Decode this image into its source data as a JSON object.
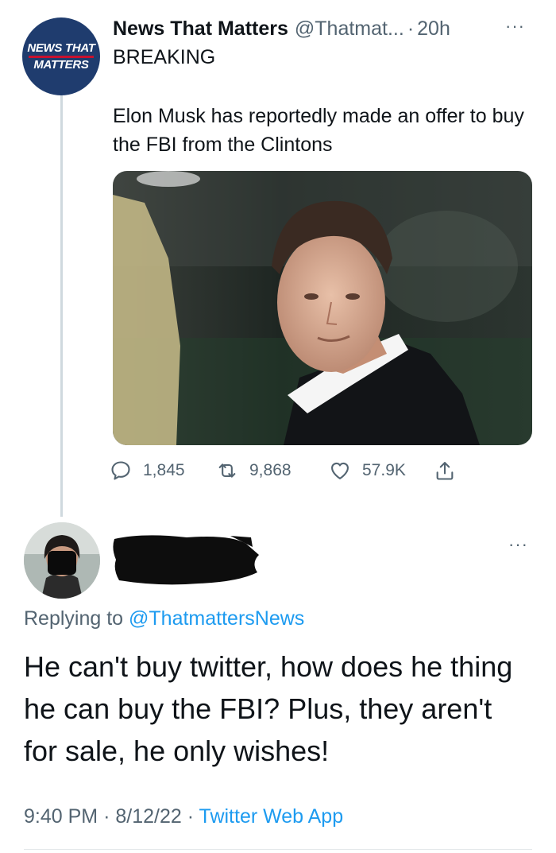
{
  "tweet": {
    "avatar_text_line1": "NEWS THAT",
    "avatar_text_line2": "MATTERS",
    "author_name": "News That Matters",
    "author_handle": "@Thatmat...",
    "separator": "·",
    "time_ago": "20h",
    "more_label": "···",
    "headline": "BREAKING",
    "text": "Elon Musk has reportedly made an offer to buy the FBI from the Clintons",
    "photo_icon": "photo-of-man-in-tuxedo",
    "stats": {
      "replies": "1,845",
      "retweets": "9,868",
      "likes": "57.9K"
    }
  },
  "reply": {
    "more_label": "···",
    "replying_prefix": "Replying to",
    "replying_mention": "@ThatmattersNews",
    "text": "He can't buy twitter, how does he thing he can buy the FBI? Plus, they aren't for sale, he only wishes!",
    "time": "9:40 PM",
    "separator_1": "·",
    "date": "8/12/22",
    "separator_2": "·",
    "source": "Twitter Web App"
  },
  "colors": {
    "link_blue": "#1d9bf0",
    "secondary_text": "#536471",
    "avatar_navy": "#1f3c6e",
    "avatar_red": "#c8102e"
  }
}
